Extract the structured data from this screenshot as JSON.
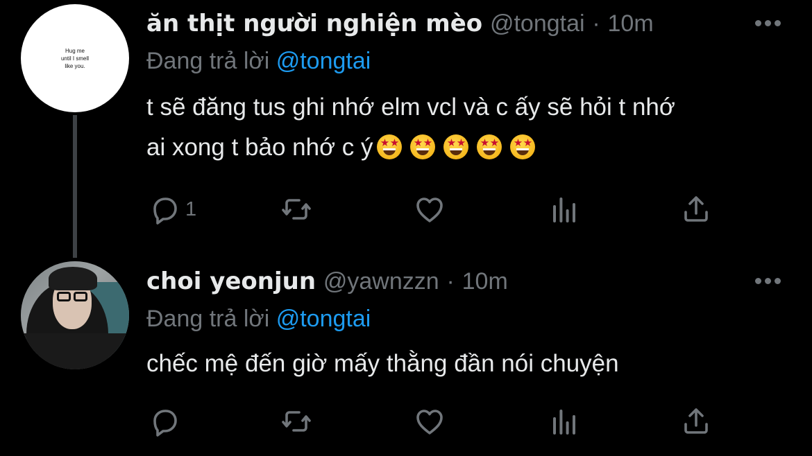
{
  "tweets": [
    {
      "display_name": "ăn thịt người nghiện mèo",
      "handle": "@tongtai",
      "separator": "·",
      "time": "10m",
      "reply_prefix": "Đang trả lời",
      "reply_to": "@tongtai",
      "body_lines": [
        "t sẽ đăng tus ghi nhớ elm vcl và c ấy sẽ hỏi t nhớ",
        "ai xong t bảo nhớ c ý"
      ],
      "body_emoji": [
        "star-struck",
        "star-struck",
        "star-struck",
        "star-struck",
        "star-struck"
      ],
      "avatar": {
        "type": "text-card",
        "lines": [
          "Hug me",
          "until I smell",
          "like you."
        ]
      },
      "actions": {
        "reply_count": "1",
        "retweet_count": "",
        "like_count": ""
      }
    },
    {
      "display_name": "choi yeonjun",
      "handle": "@yawnzzn",
      "separator": "·",
      "time": "10m",
      "reply_prefix": "Đang trả lời",
      "reply_to": "@tongtai",
      "body_lines": [
        "chếc mệ đến giờ mấy thằng đần nói chuyện"
      ],
      "avatar": {
        "type": "photo"
      },
      "actions": {
        "reply_count": "",
        "retweet_count": "",
        "like_count": ""
      }
    }
  ],
  "icons": {
    "reply": "reply-icon",
    "retweet": "retweet-icon",
    "like": "heart-icon",
    "stats": "analytics-icon",
    "share": "share-icon",
    "more": "more-icon"
  },
  "colors": {
    "background": "#000000",
    "text": "#e7e9ea",
    "muted": "#71767b",
    "link": "#1d9bf0",
    "thread_line": "#3d4145"
  }
}
